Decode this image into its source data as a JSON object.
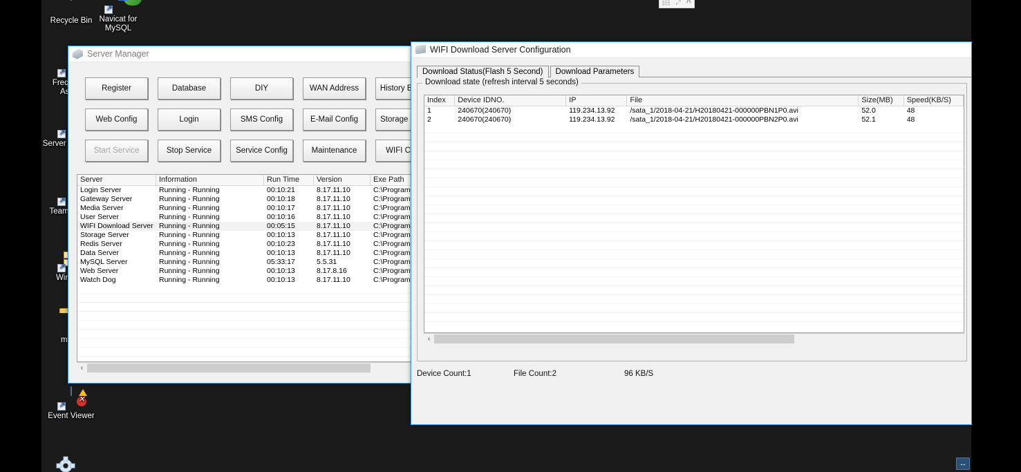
{
  "desktop": {
    "background_color": "#1b1b1b",
    "icons": [
      {
        "name": "recycle-bin",
        "label": "Recycle Bin",
        "glyph": "recycle-bin-icon",
        "shortcut": false
      },
      {
        "name": "navicat",
        "label": "Navicat for MySQL",
        "glyph": "navicat-icon",
        "shortcut": true
      },
      {
        "name": "faq",
        "label": "Frequently Asked",
        "glyph": "internet-explorer-icon",
        "shortcut": true
      },
      {
        "name": "server-manager",
        "label": "Server Manager",
        "glyph": "server-manager-icon",
        "shortcut": true
      },
      {
        "name": "teamviewer",
        "label": "TeamViewer",
        "glyph": "teamviewer-icon",
        "shortcut": true
      },
      {
        "name": "winrar",
        "label": "WinRAR",
        "glyph": "archive-icon",
        "shortcut": true
      },
      {
        "name": "mysql-folder",
        "label": "mysql",
        "glyph": "folder-icon",
        "shortcut": false
      },
      {
        "name": "event-viewer",
        "label": "Event Viewer",
        "glyph": "event-viewer-icon",
        "shortcut": true
      }
    ],
    "float_toolbar": {
      "grid": "grid-icon",
      "expand": "expand-icon",
      "collapse": "chevron-up-icon"
    },
    "gear": "settings-gear-icon",
    "tray": "window-restore-icon"
  },
  "server_manager": {
    "title": "Server Manager",
    "title_icon": "server-manager-icon",
    "buttons": [
      {
        "label": "Register",
        "disabled": false
      },
      {
        "label": "Database",
        "disabled": false
      },
      {
        "label": "DIY",
        "disabled": false
      },
      {
        "label": "WAN Address",
        "disabled": false
      },
      {
        "label": "History Backup",
        "disabled": false
      },
      {
        "label": "",
        "disabled": false
      },
      {
        "label": "Web Config",
        "disabled": false
      },
      {
        "label": "Login",
        "disabled": false
      },
      {
        "label": "SMS Config",
        "disabled": false
      },
      {
        "label": "E-Mail Config",
        "disabled": false
      },
      {
        "label": "Storage Config",
        "disabled": false
      },
      {
        "label": "",
        "disabled": false
      },
      {
        "label": "Start Service",
        "disabled": true
      },
      {
        "label": "Stop Service",
        "disabled": false
      },
      {
        "label": "Service Config",
        "disabled": false
      },
      {
        "label": "Maintenance",
        "disabled": false
      },
      {
        "label": "WIFI Config",
        "disabled": false
      },
      {
        "label": "",
        "disabled": false
      }
    ],
    "table": {
      "columns": [
        "Server",
        "Information",
        "Run Time",
        "Version",
        "Exe Path"
      ],
      "rows": [
        [
          "Login Server",
          "Running - Running",
          "00:10:21",
          "8.17.11.10",
          "C:\\Program"
        ],
        [
          "Gateway Server",
          "Running - Running",
          "00:10:18",
          "8.17.11.10",
          "C:\\Program"
        ],
        [
          "Media Server",
          "Running - Running",
          "00:10:17",
          "8.17.11.10",
          "C:\\Program"
        ],
        [
          "User Server",
          "Running - Running",
          "00:10:16",
          "8.17.11.10",
          "C:\\Program"
        ],
        [
          "WIFI Download Server",
          "Running - Running",
          "00:05:15",
          "8.17.11.10",
          "C:\\Program"
        ],
        [
          "Storage Server",
          "Running - Running",
          "00:10:13",
          "8.17.11.10",
          "C:\\Program"
        ],
        [
          "Redis Server",
          "Running - Running",
          "00:10:23",
          "8.17.11.10",
          "C:\\Program"
        ],
        [
          "Data Server",
          "Running - Running",
          "00:10:13",
          "8.17.11.10",
          "C:\\Program"
        ],
        [
          "MySQL Server",
          "Running - Running",
          "05:33:17",
          "5.5.31",
          "C:\\Program"
        ],
        [
          "Web Server",
          "Running - Running",
          "00:10:13",
          "8.17.8.16",
          "C:\\Program"
        ],
        [
          "Watch Dog",
          "Running - Running",
          "00:10:13",
          "8.17.11.10",
          "C:\\Program"
        ]
      ],
      "selected_row_index": 4,
      "scroll_left_arrow": "‹"
    }
  },
  "wifi_window": {
    "title": "WIFI Download Server Configuration",
    "title_icon": "wifi-download-server-icon",
    "tabs": [
      {
        "label": "Download Status(Flash 5 Second)",
        "active": true
      },
      {
        "label": "Download Parameters",
        "active": false
      }
    ],
    "group_title": "Download state (refresh interval 5 seconds)",
    "table": {
      "columns": [
        "Index",
        "Device IDNO.",
        "IP",
        "File",
        "Size(MB)",
        "Speed(KB/S)"
      ],
      "rows": [
        [
          "1",
          "240670(240670)",
          "119.234.13.92",
          "/sata_1/2018-04-21/H20180421-000000PBN1P0.avi",
          "52.0",
          "48"
        ],
        [
          "2",
          "240670(240670)",
          "119.234.13.92",
          "/sata_1/2018-04-21/H20180421-000000PBN2P0.avi",
          "52.1",
          "48"
        ]
      ],
      "scroll_left_arrow": "‹"
    },
    "status": {
      "device_count": "Device Count:1",
      "file_count": "File Count:2",
      "total_speed": "96 KB/S"
    }
  }
}
